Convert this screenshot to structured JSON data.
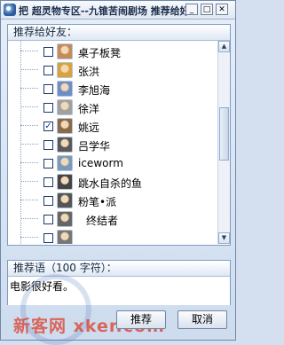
{
  "window": {
    "title": "把 超灵物专区--九锥苦闹剧场 推荐给好友"
  },
  "titlebar_buttons": {
    "minimize": "_",
    "maximize": "□",
    "close": "✕"
  },
  "friends_panel": {
    "header": "推荐给好友：",
    "items": [
      {
        "name": "桌子板凳",
        "checked": false
      },
      {
        "name": "张洪",
        "checked": false
      },
      {
        "name": "李旭海",
        "checked": false
      },
      {
        "name": "徐洋",
        "checked": false
      },
      {
        "name": "姚远",
        "checked": true
      },
      {
        "name": "吕学华",
        "checked": false
      },
      {
        "name": "iceworm",
        "checked": false
      },
      {
        "name": "跳水自杀的鱼",
        "checked": false
      },
      {
        "name": "粉笔•派",
        "checked": false
      },
      {
        "name": "终结者",
        "checked": false
      },
      {
        "name": "",
        "checked": false
      }
    ]
  },
  "message_panel": {
    "header": "推荐语（100 字符）：",
    "text": "电影很好看。"
  },
  "buttons": {
    "send": "推荐",
    "cancel": "取消"
  },
  "watermark": {
    "text": "新客网 xker.com"
  }
}
